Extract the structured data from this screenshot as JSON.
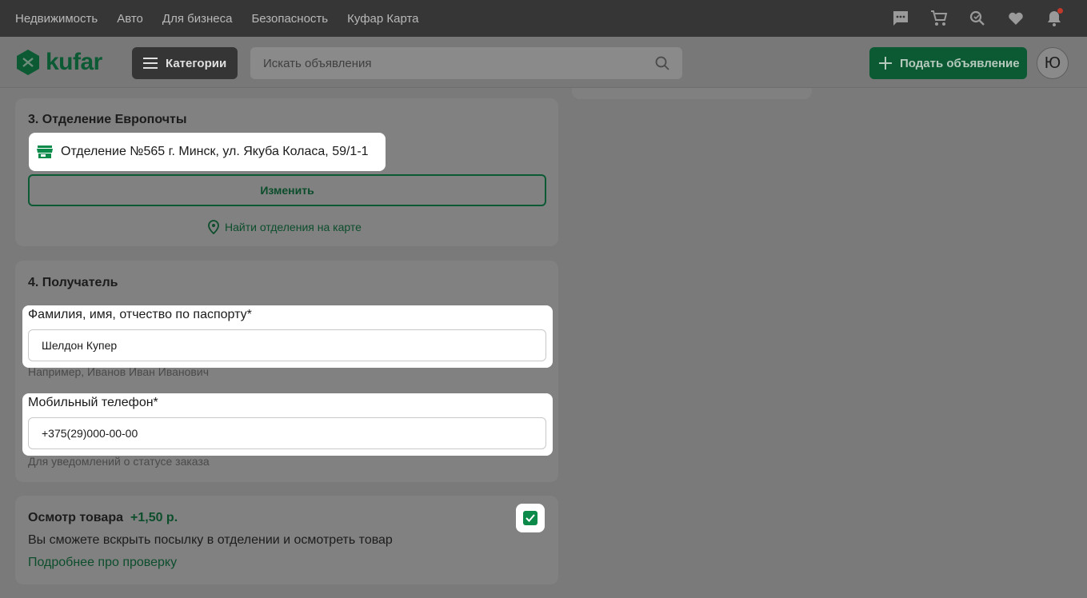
{
  "topnav": [
    "Недвижимость",
    "Авто",
    "Для бизнеса",
    "Безопасность",
    "Куфар Карта"
  ],
  "header": {
    "logo_text": "kufar",
    "categories_label": "Категории",
    "search_placeholder": "Искать объявления",
    "post_label": "Подать объявление",
    "avatar_letter": "Ю"
  },
  "icons": {
    "top": [
      "chat-icon",
      "cart-icon",
      "saved-search-icon",
      "heart-icon",
      "bell-icon"
    ]
  },
  "colors": {
    "brand": "#0c5a34",
    "accent": "#0c8a4a",
    "notification": "#c0392b"
  },
  "delivery": {
    "title": "3. Отделение Европочты",
    "address": "Отделение №565 г. Минск, ул. Якуба Коласа, 59/1-1",
    "change_label": "Изменить",
    "map_link": "Найти отделения на карте"
  },
  "recipient": {
    "title": "4. Получатель",
    "name": {
      "label": "Фамилия, имя, отчество по паспорту*",
      "value": "Шелдон Купер",
      "hint": "Например, Иванов Иван Иванович"
    },
    "phone": {
      "label": "Мобильный телефон*",
      "value": "+375(29)000-00-00",
      "hint": "Для уведомлений о статусе заказа"
    }
  },
  "inspection": {
    "title": "Осмотр товара",
    "price": "+1,50 р.",
    "description": "Вы сможете вскрыть посылку в отделении и осмотреть товар",
    "link": "Подробнее про проверку",
    "checked": true
  }
}
